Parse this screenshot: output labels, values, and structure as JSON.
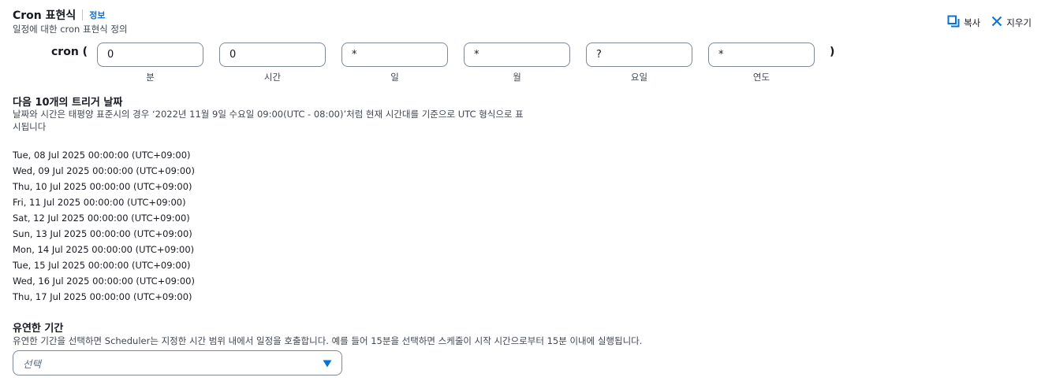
{
  "header": {
    "title": "Cron 표현식",
    "info_link": "정보",
    "subtitle": "일정에 대한 cron 표현식 정의",
    "copy_label": "복사",
    "clear_label": "지우기"
  },
  "cron": {
    "prefix": "cron (",
    "suffix": ")",
    "fields": [
      {
        "label": "분",
        "value": "0"
      },
      {
        "label": "시간",
        "value": "0"
      },
      {
        "label": "일",
        "value": "*"
      },
      {
        "label": "월",
        "value": "*"
      },
      {
        "label": "요일",
        "value": "?"
      },
      {
        "label": "연도",
        "value": "*"
      }
    ]
  },
  "triggers": {
    "title": "다음 10개의 트리거 날짜",
    "description_line1": "날짜와 시간은 태평양 표준시의 경우 ‘2022년 11월 9일 수요일 09:00(UTC - 08:00)’처럼 현재 시간대를 기준으로 UTC 형식으로 표",
    "description_line2": "시됩니다",
    "dates": [
      "Tue, 08 Jul 2025 00:00:00 (UTC+09:00)",
      "Wed, 09 Jul 2025 00:00:00 (UTC+09:00)",
      "Thu, 10 Jul 2025 00:00:00 (UTC+09:00)",
      "Fri, 11 Jul 2025 00:00:00 (UTC+09:00)",
      "Sat, 12 Jul 2025 00:00:00 (UTC+09:00)",
      "Sun, 13 Jul 2025 00:00:00 (UTC+09:00)",
      "Mon, 14 Jul 2025 00:00:00 (UTC+09:00)",
      "Tue, 15 Jul 2025 00:00:00 (UTC+09:00)",
      "Wed, 16 Jul 2025 00:00:00 (UTC+09:00)",
      "Thu, 17 Jul 2025 00:00:00 (UTC+09:00)"
    ]
  },
  "flex_window": {
    "title": "유연한 기간",
    "description": "유연한 기간을 선택하면 Scheduler는 지정한 시간 범위 내에서 일정을 호출합니다. 예를 들어 15분을 선택하면 스케줄이 시작 시간으로부터 15분 이내에 실행됩니다.",
    "select_placeholder": "선택"
  },
  "colors": {
    "link": "#0972d3",
    "text": "#16191f",
    "secondary_text": "#414750",
    "border": "#7d8998"
  },
  "icons": [
    "copy-icon",
    "close-icon",
    "caret-down-icon"
  ]
}
